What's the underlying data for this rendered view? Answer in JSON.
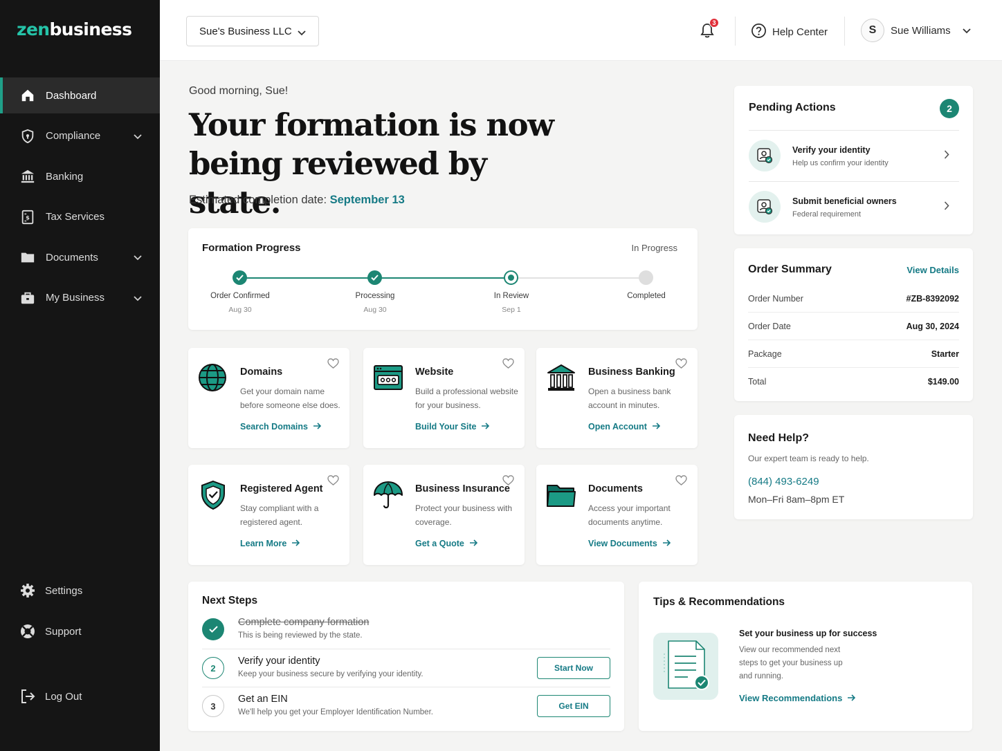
{
  "brand": {
    "logo_prefix": "zen",
    "logo_suffix": "business"
  },
  "sidebar": {
    "items": [
      {
        "label": "Dashboard",
        "icon": "home-icon",
        "active": true
      },
      {
        "label": "Compliance",
        "icon": "shield-icon",
        "expandable": true
      },
      {
        "label": "Banking",
        "icon": "bank-icon"
      },
      {
        "label": "Tax Services",
        "icon": "tax-document-icon"
      },
      {
        "label": "Documents",
        "icon": "folder-icon",
        "expandable": true
      },
      {
        "label": "My Business",
        "icon": "briefcase-icon",
        "expandable": true
      }
    ],
    "bottom": [
      {
        "label": "Settings",
        "icon": "gear-icon"
      },
      {
        "label": "Support",
        "icon": "lifebuoy-icon"
      },
      {
        "label": "Log Out",
        "icon": "logout-icon"
      }
    ]
  },
  "header": {
    "business_select": "Sue's Business LLC",
    "notification_count": "3",
    "help_label": "Help Center",
    "user_initial": "S",
    "user_name": "Sue Williams"
  },
  "hero": {
    "greeting": "Good morning, Sue!",
    "headline": "Your formation is now being reviewed by state.",
    "eta_label": "Estimated completion date:",
    "eta_date": "September 13"
  },
  "formation": {
    "title": "Formation Progress",
    "status": "In Progress",
    "progress_fraction": 0.667,
    "steps": [
      {
        "label": "Order Confirmed",
        "date": "Aug 30",
        "state": "done"
      },
      {
        "label": "Processing",
        "date": "Aug 30",
        "state": "done"
      },
      {
        "label": "In Review",
        "date": "Sep 1",
        "state": "current"
      },
      {
        "label": "Completed",
        "date": "",
        "state": "todo"
      }
    ]
  },
  "services": [
    {
      "title": "Domains",
      "desc": "Get your domain name before someone else does.",
      "link": "Search Domains",
      "icon": "globe-icon"
    },
    {
      "title": "Website",
      "desc": "Build a professional website for your business.",
      "link": "Build Your Site",
      "icon": "browser-window-icon"
    },
    {
      "title": "Business Banking",
      "desc": "Open a business bank account in minutes.",
      "link": "Open Account",
      "icon": "bank-building-icon"
    },
    {
      "title": "Registered Agent",
      "desc": "Stay compliant with a registered agent.",
      "link": "Learn More",
      "icon": "shield-check-icon"
    },
    {
      "title": "Business Insurance",
      "desc": "Protect your business with coverage.",
      "link": "Get a Quote",
      "icon": "umbrella-icon"
    },
    {
      "title": "Documents",
      "desc": "Access your important documents anytime.",
      "link": "View Documents",
      "icon": "folder-icon"
    }
  ],
  "pending": {
    "title": "Pending Actions",
    "count": "2",
    "items": [
      {
        "title": "Verify your identity",
        "sub": "Help us confirm your identity",
        "icon": "id-verify-icon"
      },
      {
        "title": "Submit beneficial owners",
        "sub": "Federal requirement",
        "icon": "id-verify-icon"
      }
    ]
  },
  "order": {
    "title": "Order Summary",
    "link": "View Details",
    "rows": [
      {
        "k": "Order Number",
        "v": "#ZB-8392092"
      },
      {
        "k": "Order Date",
        "v": "Aug 30, 2024"
      },
      {
        "k": "Package",
        "v": "Starter"
      },
      {
        "k": "Total",
        "v": "$149.00"
      }
    ]
  },
  "help": {
    "title": "Need Help?",
    "sub": "Our expert team is ready to help.",
    "phone": "(844) 493-6249",
    "hours": "Mon–Fri 8am–8pm ET"
  },
  "next_steps": {
    "title": "Next Steps",
    "items": [
      {
        "num": "",
        "title": "Complete company formation",
        "sub": "This is being reviewed by the state.",
        "state": "done",
        "button": ""
      },
      {
        "num": "2",
        "title": "Verify your identity",
        "sub": "Keep your business secure by verifying your identity.",
        "state": "active",
        "button": "Start Now"
      },
      {
        "num": "3",
        "title": "Get an EIN",
        "sub": "We'll help you get your Employer Identification Number.",
        "state": "todo",
        "button": "Get EIN"
      }
    ]
  },
  "tips": {
    "title": "Tips & Recommendations",
    "heading": "Set your business up for success",
    "desc": "View our recommended next steps to get your business up and running.",
    "link": "View Recommendations"
  },
  "colors": {
    "accent": "#1c8673",
    "link": "#157a85",
    "sidebar_bg": "#151515",
    "badge_red": "#e0303a"
  }
}
